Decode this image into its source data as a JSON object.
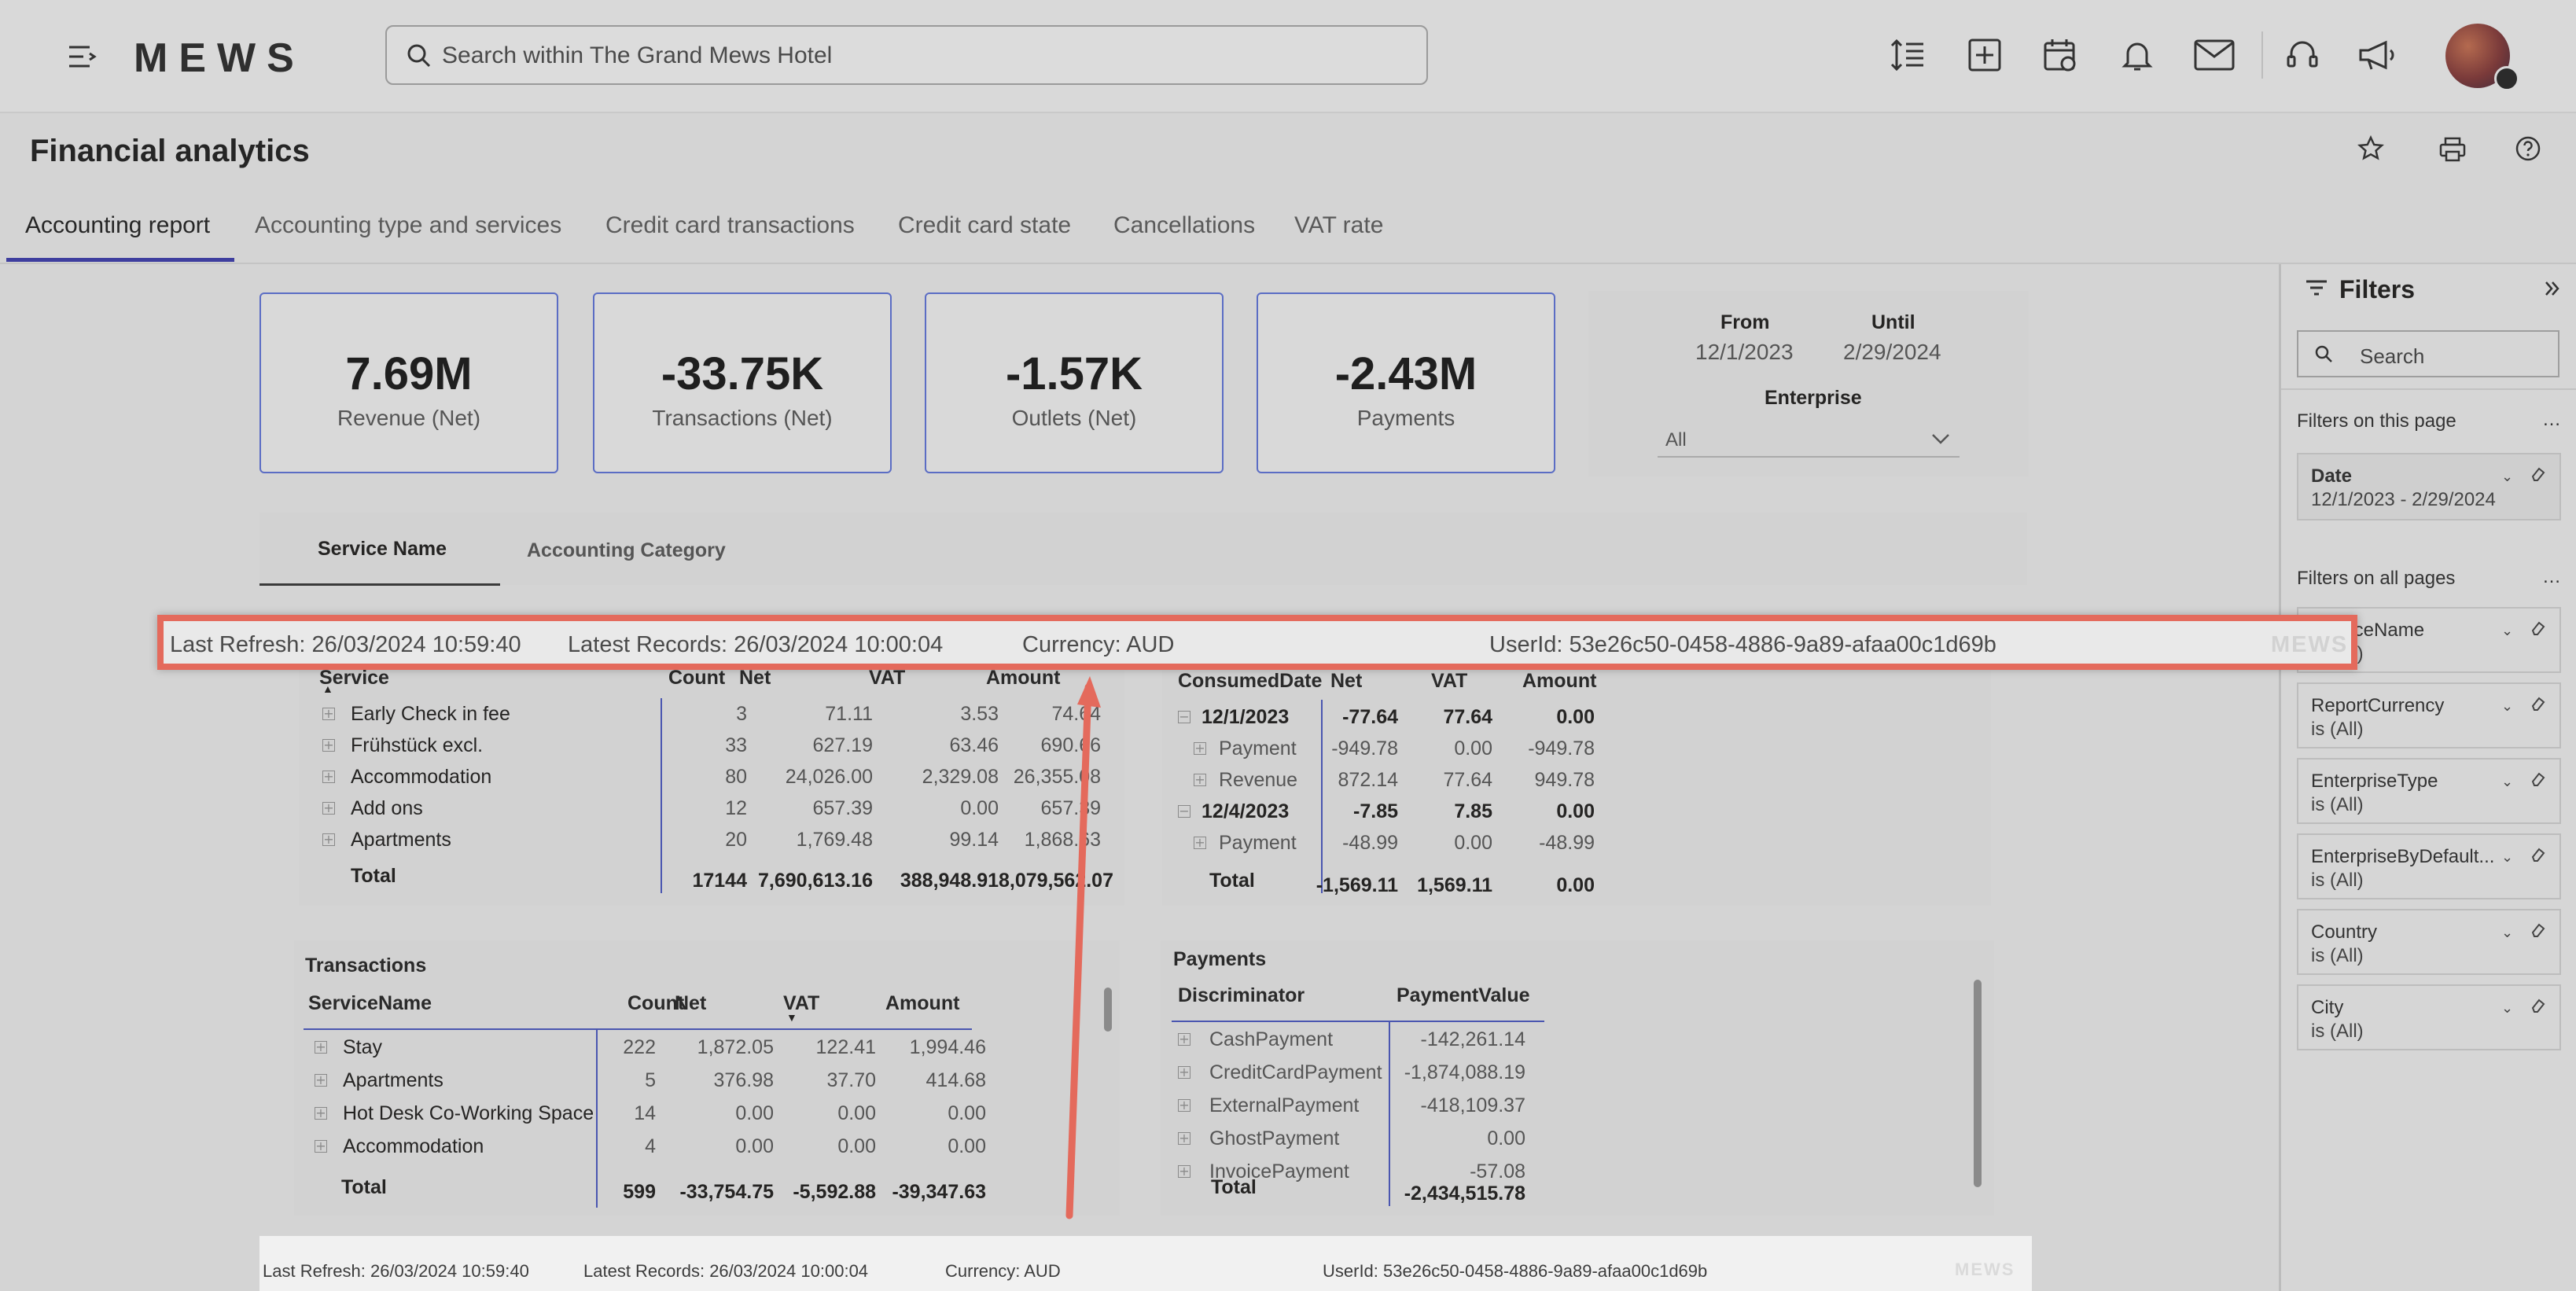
{
  "header": {
    "logo": "MEWS",
    "search_placeholder": "Search within The Grand Mews Hotel",
    "icons": [
      "menu-collapse-icon",
      "line-spacing-icon",
      "add-box-icon",
      "calendar-icon",
      "bell-icon",
      "mail-icon",
      "headset-icon",
      "megaphone-icon"
    ]
  },
  "page": {
    "title": "Financial analytics",
    "tabs": [
      {
        "label": "Accounting report",
        "active": true
      },
      {
        "label": "Accounting type and services"
      },
      {
        "label": "Credit card transactions"
      },
      {
        "label": "Credit card state"
      },
      {
        "label": "Cancellations"
      },
      {
        "label": "VAT rate"
      }
    ]
  },
  "kpis": [
    {
      "value": "7.69M",
      "label": "Revenue (Net)"
    },
    {
      "value": "-33.75K",
      "label": "Transactions (Net)"
    },
    {
      "value": "-1.57K",
      "label": "Outlets (Net)"
    },
    {
      "value": "-2.43M",
      "label": "Payments"
    }
  ],
  "date_filter": {
    "from_label": "From",
    "from_value": "12/1/2023",
    "until_label": "Until",
    "until_value": "2/29/2024",
    "enterprise_label": "Enterprise",
    "enterprise_value": "All"
  },
  "subtabs": {
    "service": "Service Name",
    "category": "Accounting Category"
  },
  "service_table": {
    "headers": [
      "Service",
      "Count",
      "Net",
      "VAT",
      "Amount"
    ],
    "rows": [
      [
        "Early Check in fee",
        "3",
        "71.11",
        "3.53",
        "74.64"
      ],
      [
        "Frühstück excl.",
        "33",
        "627.19",
        "63.46",
        "690.66"
      ],
      [
        "Accommodation",
        "80",
        "24,026.00",
        "2,329.08",
        "26,355.08"
      ],
      [
        "Add ons",
        "12",
        "657.39",
        "0.00",
        "657.39"
      ],
      [
        "Apartments",
        "20",
        "1,769.48",
        "99.14",
        "1,868.63"
      ]
    ],
    "total": [
      "Total",
      "17144",
      "7,690,613.16",
      "388,948.91",
      "8,079,562.07"
    ]
  },
  "outlet_table": {
    "headers": [
      "ConsumedDate",
      "Net",
      "VAT",
      "Amount"
    ],
    "rows": [
      {
        "label": "12/1/2023",
        "bold": true,
        "vals": [
          "-77.64",
          "77.64",
          "0.00"
        ],
        "toggle": "minus"
      },
      {
        "label": "Payment",
        "vals": [
          "-949.78",
          "0.00",
          "-949.78"
        ],
        "toggle": "plus"
      },
      {
        "label": "Revenue",
        "vals": [
          "872.14",
          "77.64",
          "949.78"
        ],
        "toggle": "plus"
      },
      {
        "label": "12/4/2023",
        "bold": true,
        "vals": [
          "-7.85",
          "7.85",
          "0.00"
        ],
        "toggle": "minus"
      },
      {
        "label": "Payment",
        "vals": [
          "-48.99",
          "0.00",
          "-48.99"
        ],
        "toggle": "plus"
      }
    ],
    "total": [
      "Total",
      "-1,569.11",
      "1,569.11",
      "0.00"
    ]
  },
  "transactions": {
    "title": "Transactions",
    "headers": [
      "ServiceName",
      "Count",
      "Net",
      "VAT",
      "Amount"
    ],
    "rows": [
      [
        "Stay",
        "222",
        "1,872.05",
        "122.41",
        "1,994.46"
      ],
      [
        "Apartments",
        "5",
        "376.98",
        "37.70",
        "414.68"
      ],
      [
        "Hot Desk Co-Working Space",
        "14",
        "0.00",
        "0.00",
        "0.00"
      ],
      [
        "Accommodation",
        "4",
        "0.00",
        "0.00",
        "0.00"
      ]
    ],
    "total": [
      "Total",
      "599",
      "-33,754.75",
      "-5,592.88",
      "-39,347.63"
    ]
  },
  "payments": {
    "title": "Payments",
    "headers": [
      "Discriminator",
      "PaymentValue"
    ],
    "rows": [
      [
        "CashPayment",
        "-142,261.14"
      ],
      [
        "CreditCardPayment",
        "-1,874,088.19"
      ],
      [
        "ExternalPayment",
        "-418,109.37"
      ],
      [
        "GhostPayment",
        "0.00"
      ],
      [
        "InvoicePayment",
        "-57.08"
      ]
    ],
    "total": [
      "Total",
      "-2,434,515.78"
    ]
  },
  "filters": {
    "title": "Filters",
    "search_placeholder": "Search",
    "on_page_label": "Filters on this page",
    "all_pages_label": "Filters on all pages",
    "date_card": {
      "title": "Date",
      "value": "12/1/2023 - 2/29/2024"
    },
    "cards": [
      {
        "title": "ServiceName",
        "value": "is (All)"
      },
      {
        "title": "ReportCurrency",
        "value": "is (All)"
      },
      {
        "title": "EnterpriseType",
        "value": "is (All)"
      },
      {
        "title": "EnterpriseByDefault...",
        "value": "is (All)"
      },
      {
        "title": "Country",
        "value": "is (All)"
      },
      {
        "title": "City",
        "value": "is (All)"
      }
    ]
  },
  "footer_info": {
    "last_refresh": "Last Refresh: 26/03/2024 10:59:40",
    "latest_records": "Latest Records: 26/03/2024 10:00:04",
    "currency": "Currency: AUD",
    "user_id": "UserId: 53e26c50-0458-4886-9a89-afaa00c1d69b",
    "brand_faint": "MEWS"
  },
  "colors": {
    "accent": "#3e3e9e",
    "highlight": "#e46a5c",
    "kpi_border": "#5b6dc4"
  }
}
